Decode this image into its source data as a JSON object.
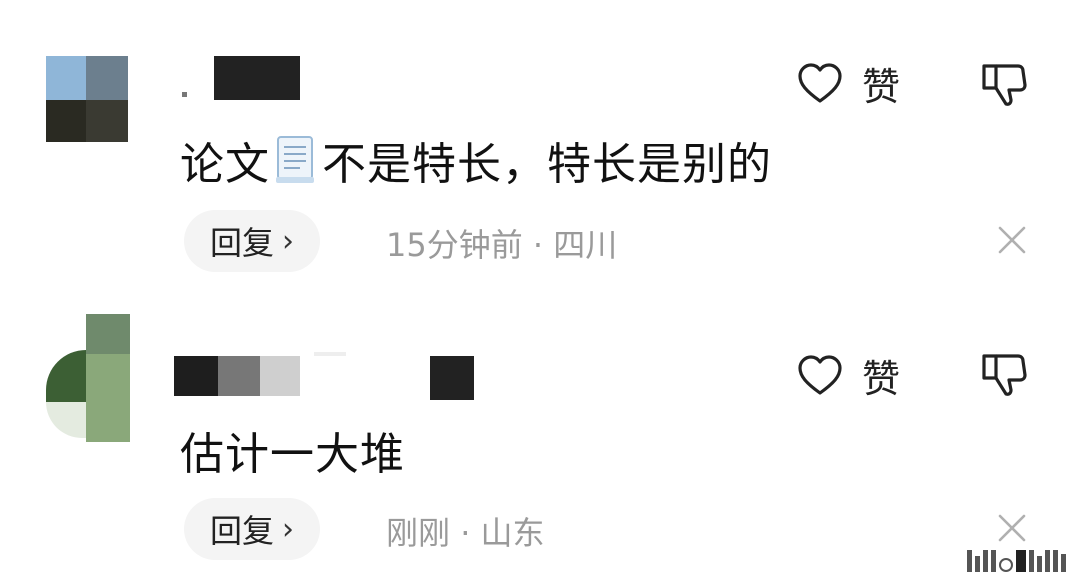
{
  "comments": [
    {
      "username": "",
      "text_before": "论文",
      "text_after": "不是特长，特长是别的",
      "inline_icon": "document-emoji-icon",
      "like_label": "赞",
      "reply_label": "回复",
      "reply_chevron": "›",
      "time": "15分钟前",
      "separator": "·",
      "location": "四川"
    },
    {
      "username": "",
      "text_before": "估计一大堆",
      "text_after": "",
      "like_label": "赞",
      "reply_label": "回复",
      "reply_chevron": "›",
      "time": "刚刚",
      "separator": "·",
      "location": "山东"
    }
  ],
  "icons": {
    "like": "heart-outline-icon",
    "dislike": "thumbs-down-outline-icon",
    "close": "close-x-icon"
  },
  "colors": {
    "text": "#111111",
    "meta": "#9a9a9a",
    "reply_bg": "#f4f4f4"
  }
}
